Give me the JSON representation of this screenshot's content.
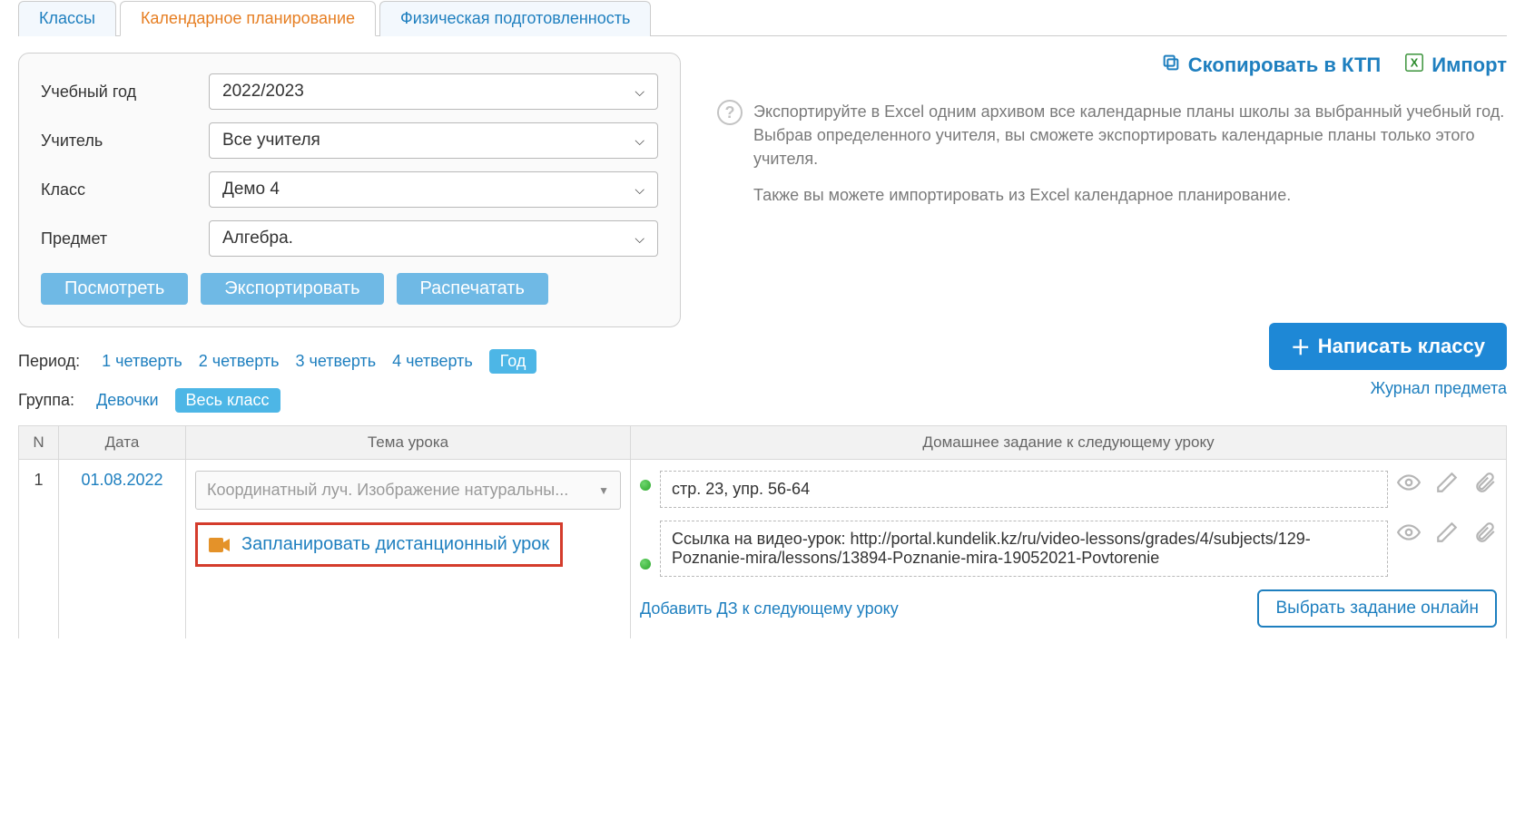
{
  "tabs": {
    "classes": "Классы",
    "planning": "Календарное планирование",
    "fitness": "Физическая подготовленность"
  },
  "filters": {
    "year_label": "Учебный год",
    "year_value": "2022/2023",
    "teacher_label": "Учитель",
    "teacher_value": "Все учителя",
    "class_label": "Класс",
    "class_value": "Демо 4",
    "subject_label": "Предмет",
    "subject_value": "Алгебра.",
    "view_btn": "Посмотреть",
    "export_btn": "Экспортировать",
    "print_btn": "Распечатать"
  },
  "right_actions": {
    "copy": "Скопировать в КТП",
    "import": "Импорт"
  },
  "help_text_1": "Экспортируйте в Excel одним архивом все календарные планы школы за выбранный учебный год. Выбрав определенного учителя, вы сможете экспортировать календарные планы только этого учителя.",
  "help_text_2": "Также вы можете импортировать из Excel календарное планирование.",
  "period": {
    "label": "Период:",
    "q1": "1 четверть",
    "q2": "2 четверть",
    "q3": "3 четверть",
    "q4": "4 четверть",
    "year": "Год"
  },
  "group": {
    "label": "Группа:",
    "girls": "Девочки",
    "all": "Весь класс"
  },
  "write_class_btn": "Написать классу",
  "journal_link": "Журнал предмета",
  "table": {
    "head_n": "N",
    "head_date": "Дата",
    "head_topic": "Тема урока",
    "head_hw": "Домашнее задание к следующему уроку",
    "row": {
      "n": "1",
      "date": "01.08.2022",
      "topic_placeholder": "Координатный луч. Изображение натуральны...",
      "distance_link": "Запланировать дистанционный урок",
      "hw1": "стр. 23, упр. 56-64",
      "hw2": "Ссылка на видео-урок: http://portal.kundelik.kz/ru/video-lessons/grades/4/subjects/129-Poznanie-mira/lessons/13894-Poznanie-mira-19052021-Povtorenie",
      "add_hw": "Добавить ДЗ к следующему уроку",
      "online_task": "Выбрать задание онлайн"
    }
  }
}
